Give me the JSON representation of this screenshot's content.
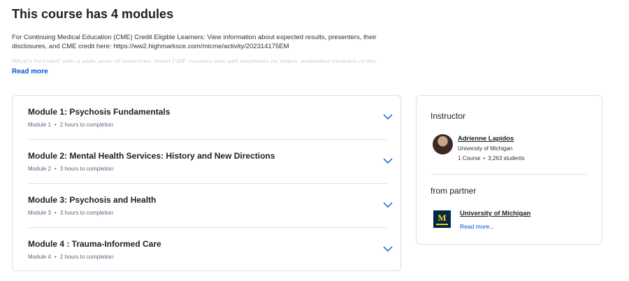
{
  "page": {
    "heading": "This course has 4 modules",
    "description": "For Continuing Medical Education (CME) Credit Eligible Learners: View information about expected results, presenters, their disclosures, and CME credit here: https://ww2.highmarksce.com/micme/activity/202314175EM",
    "description_faded": "What's Included: with a wide array of resources, loved CME courses and with emphasis on topics, extending modules of this education...",
    "read_more": "Read more"
  },
  "modules": [
    {
      "title": "Module 1: Psychosis Fundamentals",
      "label": "Module 1",
      "duration": "2 hours to completion"
    },
    {
      "title": "Module 2: Mental Health Services: History and New Directions",
      "label": "Module 2",
      "duration": "3 hours to completion"
    },
    {
      "title": "Module 3: Psychosis and Health",
      "label": "Module 3",
      "duration": "3 hours to completion"
    },
    {
      "title": "Module 4 : Trauma-Informed Care",
      "label": "Module 4",
      "duration": "2 hours to completion"
    }
  ],
  "meta_separator": "•",
  "instructor": {
    "heading": "Instructor",
    "name": "Adrienne Lapidos",
    "org": "University of Michigan",
    "courses": "1 Course",
    "students": "3,263 students"
  },
  "partner": {
    "heading": "from partner",
    "name": "University of Michigan",
    "read_more": "Read more...",
    "logo_letter": "M"
  },
  "colors": {
    "link_blue": "#0056d2",
    "umich_blue": "#00274c",
    "umich_maize": "#ffcb05"
  }
}
